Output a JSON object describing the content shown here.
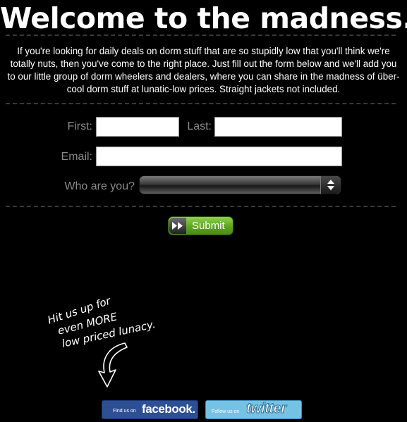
{
  "header": {
    "title": "Welcome to the madness."
  },
  "intro": {
    "text": "If you're looking for daily deals on dorm stuff that are so stupidly low that you'll think we're totally nuts, then you've come to the right place. Just fill out the form below and we'll add you to our little group of dorm wheelers and dealers, where you can share in the madness of über-cool dorm stuff at lunatic-low prices. Straight jackets not included."
  },
  "form": {
    "first_label": "First:",
    "first_value": "",
    "last_label": "Last:",
    "last_value": "",
    "email_label": "Email:",
    "email_value": "",
    "who_label": "Who are you?",
    "who_value": "",
    "submit_label": "Submit"
  },
  "promo": {
    "line1": "Hit us up for",
    "line2": "even MORE",
    "line3": "low priced lunacy."
  },
  "social": {
    "facebook_small": "Find us on",
    "facebook_big": "facebook.",
    "twitter_small": "Follow us on",
    "twitter_big": "twitter"
  },
  "colors": {
    "background": "#000000",
    "label": "#8a8a8a",
    "submit_green": "#6ab42a",
    "facebook_blue": "#2d4f94",
    "twitter_blue": "#76c2e4"
  }
}
